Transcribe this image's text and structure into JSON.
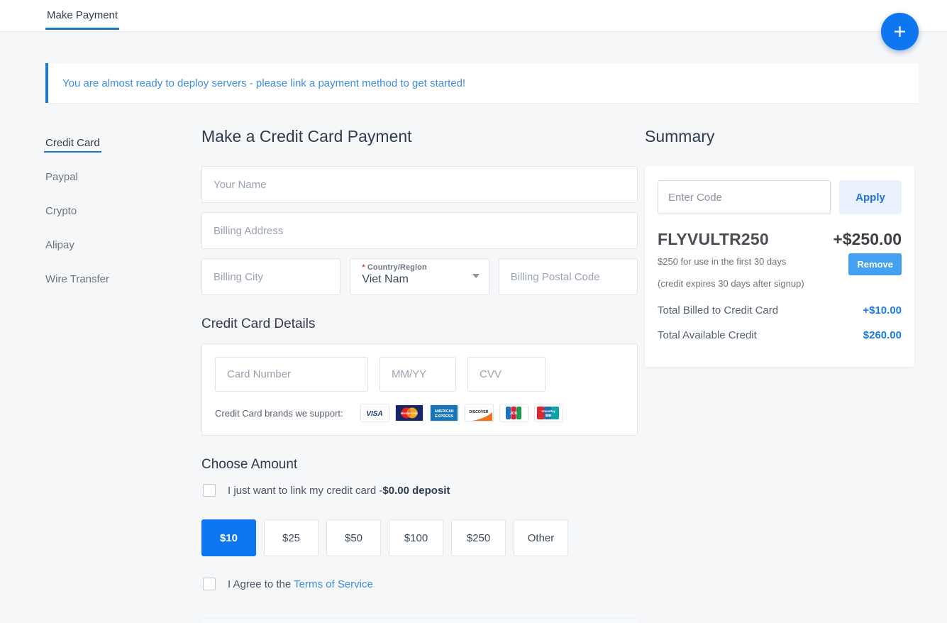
{
  "topbar": {
    "tabs": [
      {
        "label": "Make Payment",
        "active": true
      }
    ],
    "fab": {
      "icon": "plus-icon",
      "accent": "#0d76f0"
    }
  },
  "banner": {
    "text": "You are almost ready to deploy servers - please link a payment method to get started!",
    "accent": "#1878c9",
    "text_color": "#3d8ddd"
  },
  "payment_methods": [
    {
      "label": "Credit Card",
      "active": true
    },
    {
      "label": "Paypal",
      "active": false
    },
    {
      "label": "Crypto",
      "active": false
    },
    {
      "label": "Alipay",
      "active": false
    },
    {
      "label": "Wire Transfer",
      "active": false
    }
  ],
  "form": {
    "title": "Make a Credit Card Payment",
    "name": {
      "placeholder": "Your Name",
      "value": ""
    },
    "address": {
      "placeholder": "Billing Address",
      "value": ""
    },
    "city": {
      "placeholder": "Billing City",
      "value": ""
    },
    "country": {
      "label": "Country/Region",
      "required_marker": "*",
      "value": "Viet Nam"
    },
    "postal": {
      "placeholder": "Billing Postal Code",
      "value": ""
    },
    "card_section_title": "Credit Card Details",
    "card_number": {
      "placeholder": "Card Number",
      "value": ""
    },
    "card_expiry": {
      "placeholder": "MM/YY",
      "value": ""
    },
    "card_cvv": {
      "placeholder": "CVV",
      "value": ""
    },
    "brands_label": "Credit Card brands we support:",
    "brands": [
      "VISA",
      "MasterCard",
      "American Express",
      "Discover",
      "JCB",
      "UnionPay"
    ]
  },
  "amount": {
    "title": "Choose Amount",
    "link_only": {
      "text": "I just want to link my credit card -",
      "bold": "$0.00 deposit",
      "checked": false
    },
    "options": [
      {
        "label": "$10",
        "selected": true
      },
      {
        "label": "$25",
        "selected": false
      },
      {
        "label": "$50",
        "selected": false
      },
      {
        "label": "$100",
        "selected": false
      },
      {
        "label": "$250",
        "selected": false
      },
      {
        "label": "Other",
        "selected": false
      }
    ],
    "tos": {
      "text": "I Agree to the ",
      "link": "Terms of Service",
      "checked": false
    },
    "selected_color": "#0d76f0"
  },
  "summary": {
    "title": "Summary",
    "code_input": {
      "placeholder": "Enter Code",
      "value": ""
    },
    "apply_label": "Apply",
    "promo": {
      "code": "FLYVULTR250",
      "amount": "+$250.00",
      "note": "$250 for use in the first 30 days",
      "note2": "(credit expires 30 days after signup)",
      "remove_label": "Remove"
    },
    "totals": [
      {
        "label": "Total Billed to Credit Card",
        "value": "+$10.00"
      },
      {
        "label": "Total Available Credit",
        "value": "$260.00"
      }
    ],
    "value_color": "#1a7ae8"
  }
}
